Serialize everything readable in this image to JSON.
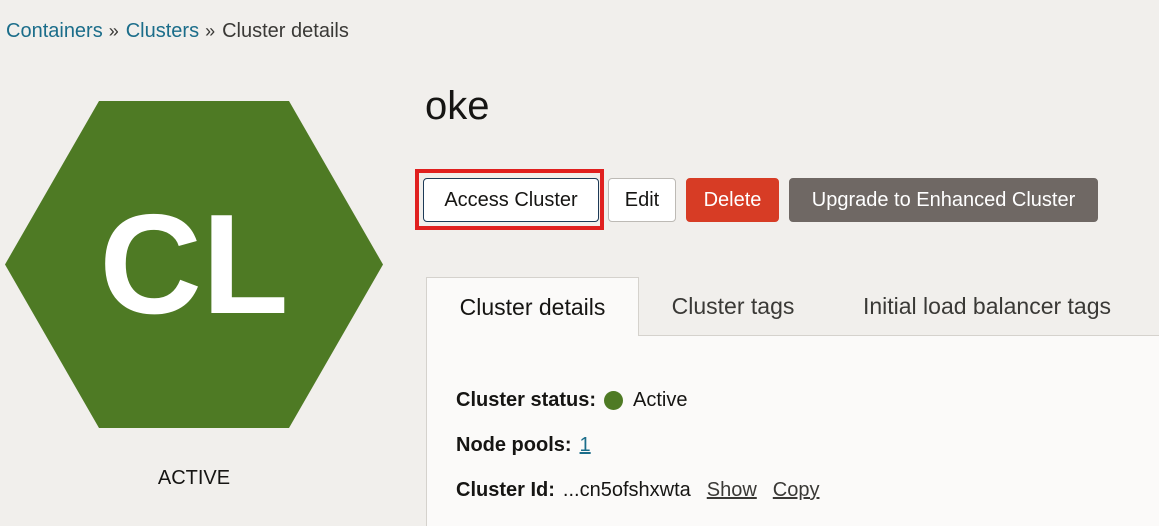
{
  "breadcrumb": {
    "items": [
      {
        "label": "Containers"
      },
      {
        "label": "Clusters"
      }
    ],
    "separator": "»",
    "current": "Cluster details"
  },
  "resource": {
    "initials": "CL",
    "status_caption": "ACTIVE",
    "name": "oke",
    "hex_color": "#4e7a24"
  },
  "actions": {
    "access": "Access Cluster",
    "edit": "Edit",
    "delete": "Delete",
    "upgrade": "Upgrade to Enhanced Cluster"
  },
  "tabs": [
    {
      "label": "Cluster details",
      "active": true
    },
    {
      "label": "Cluster tags",
      "active": false
    },
    {
      "label": "Initial load balancer tags",
      "active": false
    }
  ],
  "details": {
    "status_label": "Cluster status:",
    "status_value": "Active",
    "node_pools_label": "Node pools:",
    "node_pools_value": "1",
    "cluster_id_label": "Cluster Id:",
    "cluster_id_value": "...cn5ofshxwta",
    "show_link": "Show",
    "copy_link": "Copy"
  },
  "colors": {
    "delete": "#d73c25",
    "upgrade": "#6f6864",
    "link": "#1b6d8a",
    "highlight": "#e0201f"
  }
}
